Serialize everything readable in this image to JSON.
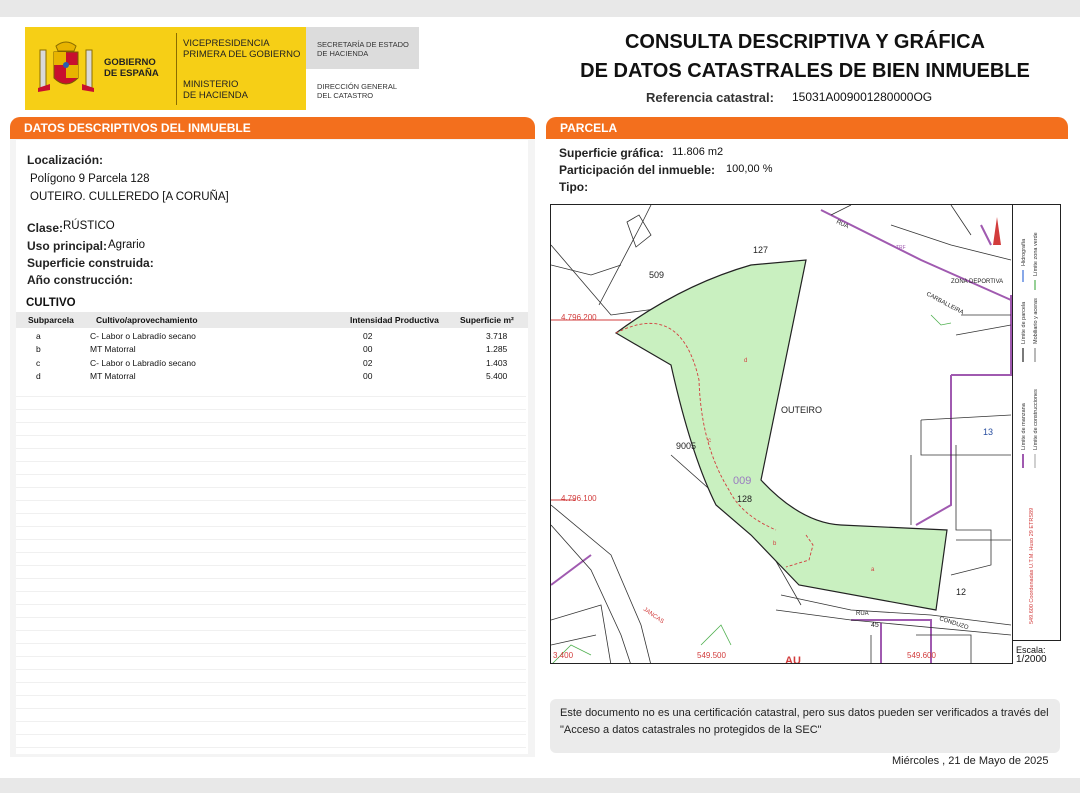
{
  "header": {
    "gobierno": [
      "GOBIERNO",
      "DE ESPAÑA"
    ],
    "vicepresidencia": [
      "VICEPRESIDENCIA",
      "PRIMERA DEL GOBIERNO"
    ],
    "ministerio": [
      "MINISTERIO",
      "DE HACIENDA"
    ],
    "secretaria": [
      "SECRETARÍA DE ESTADO",
      "DE HACIENDA"
    ],
    "direccion": [
      "DIRECCIÓN GENERAL",
      "DEL CATASTRO"
    ],
    "title_line1": "CONSULTA DESCRIPTIVA Y GRÁFICA",
    "title_line2": "DE DATOS CATASTRALES DE BIEN INMUEBLE",
    "ref_label": "Referencia catastral:",
    "ref_value": "15031A009001280000OG"
  },
  "descriptivos": {
    "heading": "DATOS DESCRIPTIVOS DEL INMUEBLE",
    "localizacion_label": "Localización:",
    "localizacion_line1": "Polígono 9 Parcela 128",
    "localizacion_line2": "OUTEIRO. CULLEREDO [A CORUÑA]",
    "clase_label": "Clase:",
    "clase_value": "RÚSTICO",
    "uso_label": "Uso principal:",
    "uso_value": "Agrario",
    "superficie_label": "Superficie construida:",
    "anio_label": "Año construcción:"
  },
  "cultivo": {
    "title": "CULTIVO",
    "headers": [
      "Subparcela",
      "Cultivo/aprovechamiento",
      "Intensidad Productiva",
      "Superficie m²"
    ],
    "rows": [
      {
        "sub": "a",
        "cultivo": "C- Labor o Labradío secano",
        "intensidad": "02",
        "superficie": "3.718"
      },
      {
        "sub": "b",
        "cultivo": "MT Matorral",
        "intensidad": "00",
        "superficie": "1.285"
      },
      {
        "sub": "c",
        "cultivo": "C- Labor o Labradío secano",
        "intensidad": "02",
        "superficie": "1.403"
      },
      {
        "sub": "d",
        "cultivo": "MT Matorral",
        "intensidad": "00",
        "superficie": "5.400"
      }
    ]
  },
  "parcela": {
    "heading": "PARCELA",
    "superficie_label": "Superficie gráfica:",
    "superficie_value": "11.806 m2",
    "participacion_label": "Participación del inmueble:",
    "participacion_value": "100,00 %",
    "tipo_label": "Tipo:"
  },
  "map": {
    "labels": {
      "p127": "127",
      "p509": "509",
      "p128": "128",
      "p12": "12",
      "p13": "13",
      "p45": "45",
      "p9005": "9005",
      "p009": "009",
      "outeiro": "OUTEIRO",
      "rua_top": "RUA",
      "zona": "ZONA DEPORTIVA",
      "carballeira": "CARBALLEIRA",
      "rua_bottom": "RUA",
      "conduzo": "CONDUZO",
      "jancas": "JANCAS",
      "au": "AU",
      "trf": "TRF",
      "sub_a": "a",
      "sub_b": "b",
      "sub_c": "c",
      "sub_d": "d",
      "coord_y1": "4.796.200",
      "coord_y2": "4.796.100",
      "coord_x1": "549.500",
      "coord_x2": "549.600",
      "coord_bl": "3.400"
    },
    "legend": [
      "Hidrografía",
      "Límite zona verde",
      "Límite de parcela",
      "Mobiliario y aceras",
      "Límite de manzana",
      "Límite de construcciones",
      "549.600 Coordenadas U.T.M. Huso 29 ETRS89"
    ],
    "scale_label": "Escala:",
    "scale_value": "1/2000"
  },
  "footer": {
    "note": "Este documento no es una certificación catastral, pero sus datos pueden ser verificados a través del \"Acceso a datos catastrales no protegidos de la SEC\"",
    "date": "Miércoles , 21 de Mayo de 2025"
  },
  "colors": {
    "accent": "#f36f1d",
    "logo_yellow": "#f6cf16",
    "parcel_fill": "#c9f0c0",
    "parcel_stroke": "#222222",
    "manzana": "#a05ab0",
    "coord_red": "#d23c3c"
  }
}
